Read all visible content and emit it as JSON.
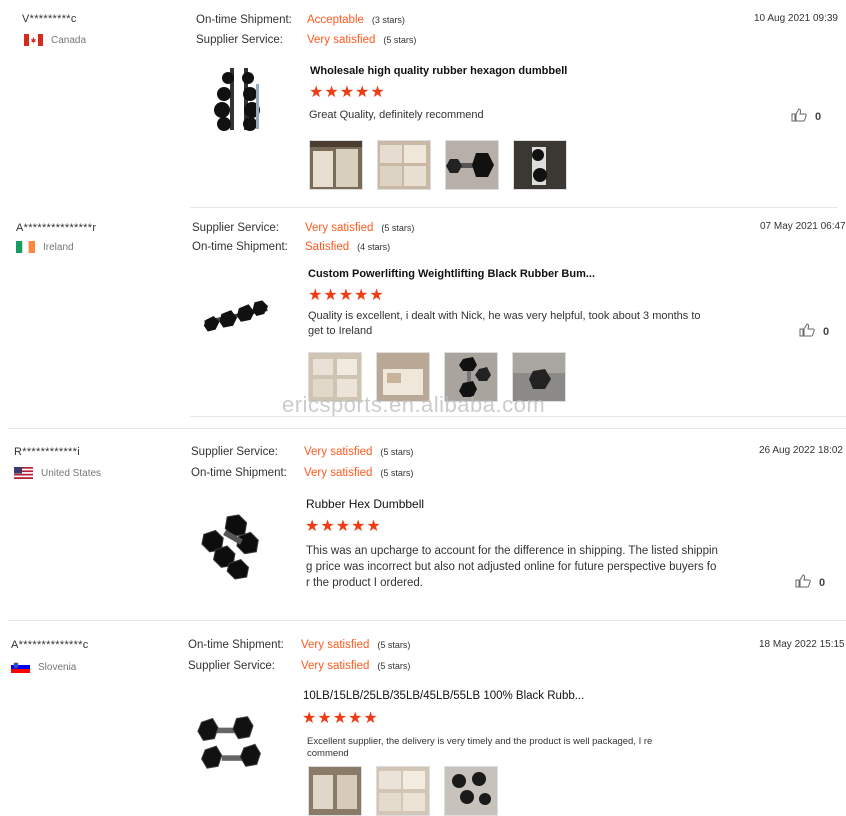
{
  "watermark": "ericsports.en.alibaba.com",
  "reviews": [
    {
      "name": "V*********c",
      "country": "Canada",
      "ratings": [
        {
          "label": "On-time Shipment:",
          "value": "Acceptable",
          "stars": "(3 stars)"
        },
        {
          "label": "Supplier Service:",
          "value": "Very satisfied",
          "stars": "(5 stars)"
        }
      ],
      "date": "10 Aug 2021 09:39",
      "product": "Wholesale high quality rubber hexagon dumbbell",
      "rating_stars": 5,
      "comment": [
        "Great Quality, definitely recommend"
      ],
      "likes": "0"
    },
    {
      "name": "A***************r",
      "country": "Ireland",
      "ratings": [
        {
          "label": "Supplier Service:",
          "value": "Very satisfied",
          "stars": "(5 stars)"
        },
        {
          "label": "On-time Shipment:",
          "value": "Satisfied",
          "stars": "(4 stars)"
        }
      ],
      "date": "07 May 2021 06:47",
      "product": "Custom Powerlifting Weightlifting Black Rubber Bum...",
      "rating_stars": 5,
      "comment": [
        "Quality is excellent, i dealt with Nick, he was very helpful, took about 3 months to",
        "get to Ireland"
      ],
      "likes": "0"
    },
    {
      "name": "R************i",
      "country": "United States",
      "ratings": [
        {
          "label": "Supplier Service:",
          "value": "Very satisfied",
          "stars": "(5 stars)"
        },
        {
          "label": "On-time Shipment:",
          "value": "Very satisfied",
          "stars": "(5 stars)"
        }
      ],
      "date": "26 Aug 2022 18:02",
      "product": "Rubber Hex Dumbbell",
      "rating_stars": 5,
      "comment": [
        "This was an upcharge to account for the difference in shipping. The listed shippin",
        "g price was incorrect but also not adjusted online for future perspective buyers fo",
        "r the product I ordered."
      ],
      "likes": "0"
    },
    {
      "name": "A**************c",
      "country": "Slovenia",
      "ratings": [
        {
          "label": "On-time Shipment:",
          "value": "Very satisfied",
          "stars": "(5 stars)"
        },
        {
          "label": "Supplier Service:",
          "value": "Very satisfied",
          "stars": "(5 stars)"
        }
      ],
      "date": "18 May 2022 15:15",
      "product": "10LB/15LB/25LB/35LB/45LB/55LB 100% Black Rubb...",
      "rating_stars": 5,
      "comment": [
        "Excellent supplier, the delivery is very timely and the product is well packaged, I re",
        "commend"
      ],
      "likes": "0"
    }
  ],
  "colors": {
    "accent": "#ff5a1f",
    "star": "#f03c14"
  }
}
